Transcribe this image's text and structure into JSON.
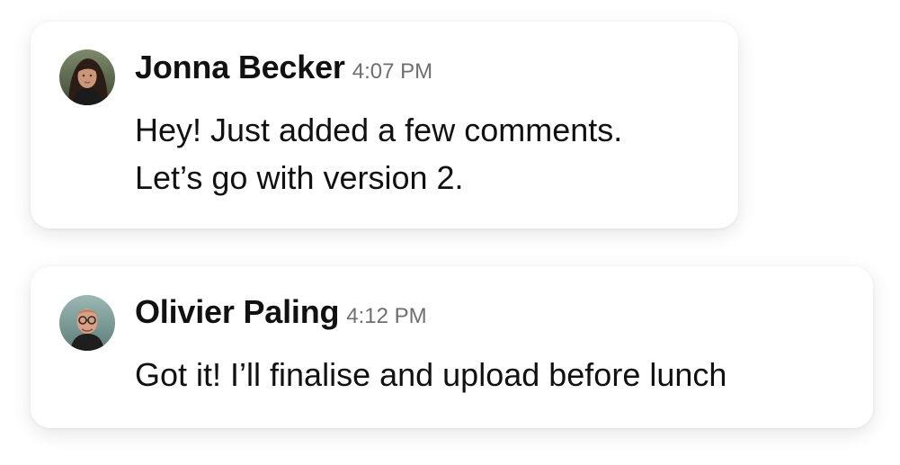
{
  "messages": [
    {
      "author": "Jonna Becker",
      "time": "4:07 PM",
      "lines": [
        "Hey! Just added a few comments.",
        "Let’s go with version 2."
      ]
    },
    {
      "author": "Olivier Paling",
      "time": "4:12 PM",
      "lines": [
        "Got it! I’ll finalise and upload before lunch"
      ]
    }
  ]
}
